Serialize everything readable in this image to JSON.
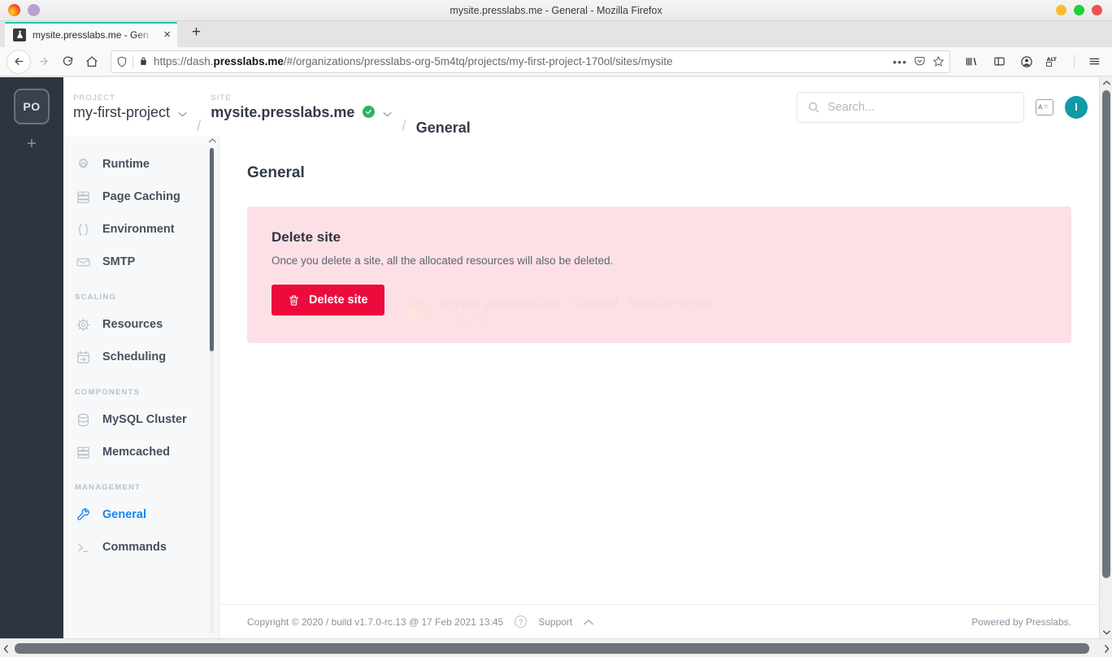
{
  "browser": {
    "window_title": "mysite.presslabs.me - General - Mozilla Firefox",
    "tab": {
      "title": "mysite.presslabs.me - Gen",
      "favicon": "flask-icon",
      "close_label": "×"
    },
    "new_tab_label": "+",
    "nav": {
      "back_label": "←",
      "forward_label": "→",
      "reload_label": "⟳",
      "home_label": "⌂"
    },
    "url": {
      "prefix": "https://dash.",
      "domain": "presslabs.me",
      "path": "/#/organizations/presslabs-org-5m4tq/projects/my-first-project-170ol/sites/mysite",
      "shield_icon": "tracking-protection-icon",
      "lock_icon": "padlock-icon",
      "page_actions_label": "•••",
      "pocket_icon": "pocket-icon",
      "bookmark_icon": "star-icon"
    },
    "toolbar_icons": [
      "library-icon",
      "sidebar-icon",
      "account-icon",
      "alt-keyboard-icon",
      "hamburger-menu-icon"
    ],
    "window_controls": {
      "minimize_color": "#fdbc2c",
      "maximize_color": "#1fd03a",
      "close_color": "#ef5054"
    }
  },
  "app": {
    "org_rail": {
      "org_badge": "PO",
      "add_label": "+"
    },
    "header": {
      "project_label": "PROJECT",
      "project_value": "my-first-project",
      "site_label": "SITE",
      "site_value": "mysite.presslabs.me",
      "site_status_icon": "check-circle-icon",
      "separator": "/",
      "page": "General",
      "search_placeholder": "Search...",
      "lang_icon_label": "A☆",
      "avatar_initial": "I",
      "avatar_color": "#0f9aa8"
    },
    "sidebar": {
      "items": [
        {
          "label": "Runtime",
          "icon": "gear-icon",
          "active": false
        },
        {
          "label": "Page Caching",
          "icon": "cache-database-icon",
          "active": false
        },
        {
          "label": "Environment",
          "icon": "braces-icon",
          "active": false
        },
        {
          "label": "SMTP",
          "icon": "envelope-icon",
          "active": false
        }
      ],
      "groups": [
        {
          "title": "SCALING",
          "items": [
            {
              "label": "Resources",
              "icon": "cpu-icon",
              "active": false
            },
            {
              "label": "Scheduling",
              "icon": "calendar-arrow-icon",
              "active": false
            }
          ]
        },
        {
          "title": "COMPONENTS",
          "items": [
            {
              "label": "MySQL Cluster",
              "icon": "database-icon",
              "active": false
            },
            {
              "label": "Memcached",
              "icon": "cache-database-icon",
              "active": false
            }
          ]
        },
        {
          "title": "MANAGEMENT",
          "items": [
            {
              "label": "General",
              "icon": "wrench-icon",
              "active": true
            },
            {
              "label": "Commands",
              "icon": "terminal-icon",
              "active": false
            }
          ]
        }
      ],
      "active_color": "#1a84f0"
    },
    "main": {
      "page_title": "General",
      "danger_card": {
        "title": "Delete site",
        "description": "Once you delete a site, all the allocated resources will also be deleted.",
        "button_label": "Delete site",
        "button_icon": "trash-icon",
        "background_color": "#fde0e5",
        "button_color": "#ec0b3c"
      },
      "ghost_overlay": {
        "line1": "mysite.presslabs.me - General - Mozilla Firefox",
        "line2": "1368x808",
        "icon": "firefox-icon"
      }
    },
    "footer": {
      "copyright": "Copyright © 2020 / build v1.7.0-rc.13 @ 17 Feb 2021 13:45",
      "help_icon": "question-mark-icon",
      "support_label": "Support",
      "collapse_icon": "chevron-up-icon",
      "powered_by": "Powered by Presslabs."
    }
  }
}
